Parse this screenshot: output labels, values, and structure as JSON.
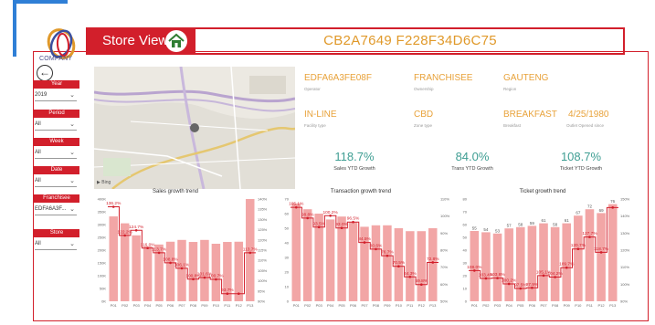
{
  "app": {
    "logo_text": "COMPANY",
    "title": "Store View",
    "store_id": "CB2A7649 F228F34D6C75"
  },
  "filters": [
    {
      "label": "Year",
      "value": "2019"
    },
    {
      "label": "Period",
      "value": "All"
    },
    {
      "label": "Week",
      "value": "All"
    },
    {
      "label": "Date",
      "value": "All"
    },
    {
      "label": "Franchisee",
      "value": "EDFA6A3F..."
    },
    {
      "label": "Store",
      "value": "All"
    }
  ],
  "map": {
    "attribution": "Bing"
  },
  "info": {
    "operator": {
      "value": "EDFA6A3FE08F",
      "label": "Operator"
    },
    "ownership": {
      "value": "FRANCHISEE",
      "label": "Ownership"
    },
    "region": {
      "value": "GAUTENG",
      "label": "Region"
    },
    "facility": {
      "value": "IN-LINE",
      "label": "Facility type"
    },
    "zone": {
      "value": "CBD",
      "label": "Zone type"
    },
    "breakfast": {
      "value": "BREAKFAST",
      "label": "Breakfast"
    },
    "opened": {
      "value": "4/25/1980",
      "label": "Outlet Opened since"
    }
  },
  "kpis": [
    {
      "value": "118.7%",
      "label": "Sales YTD Growth"
    },
    {
      "value": "84.0%",
      "label": "Trans YTD Growth"
    },
    {
      "value": "108.7%",
      "label": "Ticket YTD Growth"
    }
  ],
  "colors": {
    "bar": "#f2a6a6",
    "line": "#d21f2b",
    "accent": "#e0992a",
    "kpi": "#3f9e93"
  },
  "chart_data": [
    {
      "type": "bar",
      "title": "Sales growth trend",
      "categories": [
        "P01",
        "P02",
        "P03",
        "P04",
        "P05",
        "P06",
        "P07",
        "P08",
        "P09",
        "P10",
        "P11",
        "P12",
        "P13"
      ],
      "values": [
        332000,
        305000,
        258000,
        215000,
        222000,
        233000,
        240000,
        232000,
        240000,
        225000,
        232000,
        233000,
        400000
      ],
      "ylim": [
        0,
        400000
      ],
      "left_ticks": [
        "0K",
        "50K",
        "100K",
        "150K",
        "200K",
        "250K",
        "300K",
        "350K",
        "400K"
      ],
      "line": {
        "values": [
          136.2,
          122.2,
          124.7,
          116.0,
          113.7,
          108.8,
          106.1,
          100.8,
          101.6,
          100.7,
          93.7,
          93.7,
          113.7
        ],
        "labels": [
          "136.2%",
          "122.2%",
          "124.7%",
          "116.0%",
          "113.7%",
          "108.8%",
          "106.1%",
          "100.8%",
          "101.6%",
          "100.7%",
          "93.7%",
          "",
          "113.7%"
        ],
        "ylim": [
          90,
          140
        ],
        "right_ticks": [
          "90%",
          "95%",
          "100%",
          "105%",
          "110%",
          "115%",
          "120%",
          "125%",
          "130%",
          "135%",
          "140%"
        ]
      }
    },
    {
      "type": "bar",
      "title": "Transaction growth trend",
      "categories": [
        "P01",
        "P02",
        "P03",
        "P04",
        "P05",
        "P06",
        "P07",
        "P08",
        "P09",
        "P10",
        "P11",
        "P12",
        "P13"
      ],
      "values": [
        67,
        63,
        60,
        56,
        58,
        54,
        51,
        52,
        52,
        50,
        48,
        48,
        50
      ],
      "ylim": [
        0,
        70
      ],
      "left_ticks": [
        "0",
        "10",
        "20",
        "30",
        "40",
        "50",
        "60",
        "70"
      ],
      "line": {
        "values": [
          105.1,
          98.8,
          93.5,
          100.2,
          93.0,
          96.5,
          84.5,
          80.6,
          76.7,
          70.5,
          64.3,
          59.8,
          72.8
        ],
        "labels": [
          "105.1%",
          "98.8%",
          "93.5%",
          "100.2%",
          "93.0%",
          "96.5%",
          "84.5%",
          "80.6%",
          "76.7%",
          "70.5%",
          "64.3%",
          "59.8%",
          "72.8%"
        ],
        "ylim": [
          50,
          110
        ],
        "right_ticks": [
          "50%",
          "60%",
          "70%",
          "80%",
          "90%",
          "100%",
          "110%"
        ]
      }
    },
    {
      "type": "bar",
      "title": "Ticket growth trend",
      "categories": [
        "P01",
        "P02",
        "P03",
        "P04",
        "P05",
        "P06",
        "P07",
        "P08",
        "P09",
        "P10",
        "P11",
        "P12",
        "P13"
      ],
      "values": [
        55,
        54,
        53,
        57,
        58,
        59,
        61,
        58,
        61,
        67,
        72,
        69,
        76
      ],
      "ylim": [
        0,
        80
      ],
      "left_ticks": [
        "0",
        "10",
        "20",
        "30",
        "40",
        "50",
        "60",
        "70",
        "80"
      ],
      "line": {
        "values": [
          108.0,
          103.4,
          103.6,
          100.2,
          97.5,
          97.9,
          105.1,
          104.2,
          109.7,
          120.7,
          127.7,
          118.7,
          145.0
        ],
        "labels": [
          "108.0%",
          "103.4%",
          "103.6%",
          "100.2%",
          "97.5%",
          "97.9%",
          "105.1%",
          "104.2%",
          "109.7%",
          "120.7%",
          "127.7%",
          "118.7%",
          ""
        ],
        "ylim": [
          90,
          150
        ],
        "right_ticks": [
          "90%",
          "100%",
          "110%",
          "120%",
          "130%",
          "140%",
          "150%"
        ]
      }
    }
  ]
}
